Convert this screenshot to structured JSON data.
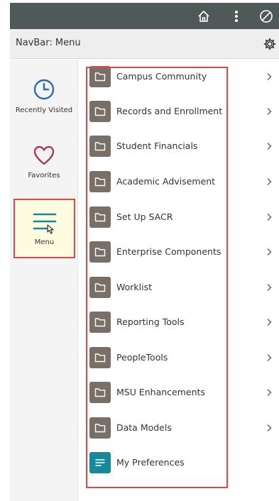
{
  "header": {
    "title": "NavBar: Menu"
  },
  "leftnav": {
    "recent_label": "Recently Visited",
    "favorites_label": "Favorites",
    "menu_label": "Menu"
  },
  "menu_items": [
    {
      "label": "Campus Community",
      "icon": "folder-icon",
      "has_chevron": true
    },
    {
      "label": "Records and Enrollment",
      "icon": "folder-icon",
      "has_chevron": true
    },
    {
      "label": "Student Financials",
      "icon": "folder-icon",
      "has_chevron": true
    },
    {
      "label": "Academic Advisement",
      "icon": "folder-icon",
      "has_chevron": true
    },
    {
      "label": "Set Up SACR",
      "icon": "folder-icon",
      "has_chevron": true
    },
    {
      "label": "Enterprise Components",
      "icon": "folder-icon",
      "has_chevron": true
    },
    {
      "label": "Worklist",
      "icon": "folder-icon",
      "has_chevron": true
    },
    {
      "label": "Reporting Tools",
      "icon": "folder-icon",
      "has_chevron": true
    },
    {
      "label": "PeopleTools",
      "icon": "folder-icon",
      "has_chevron": true
    },
    {
      "label": "MSU Enhancements",
      "icon": "folder-icon",
      "has_chevron": true
    },
    {
      "label": "Data Models",
      "icon": "folder-icon",
      "has_chevron": true
    },
    {
      "label": "My Preferences",
      "icon": "preferences-icon",
      "has_chevron": false
    }
  ],
  "colors": {
    "topbar": "#4f5a58",
    "folder_tile": "#7a6f66",
    "preferences_tile": "#168a9a",
    "highlight": "#e04848",
    "clock": "#2b6cb0",
    "heart": "#b03a52",
    "menu_lines": "#168a9a"
  }
}
